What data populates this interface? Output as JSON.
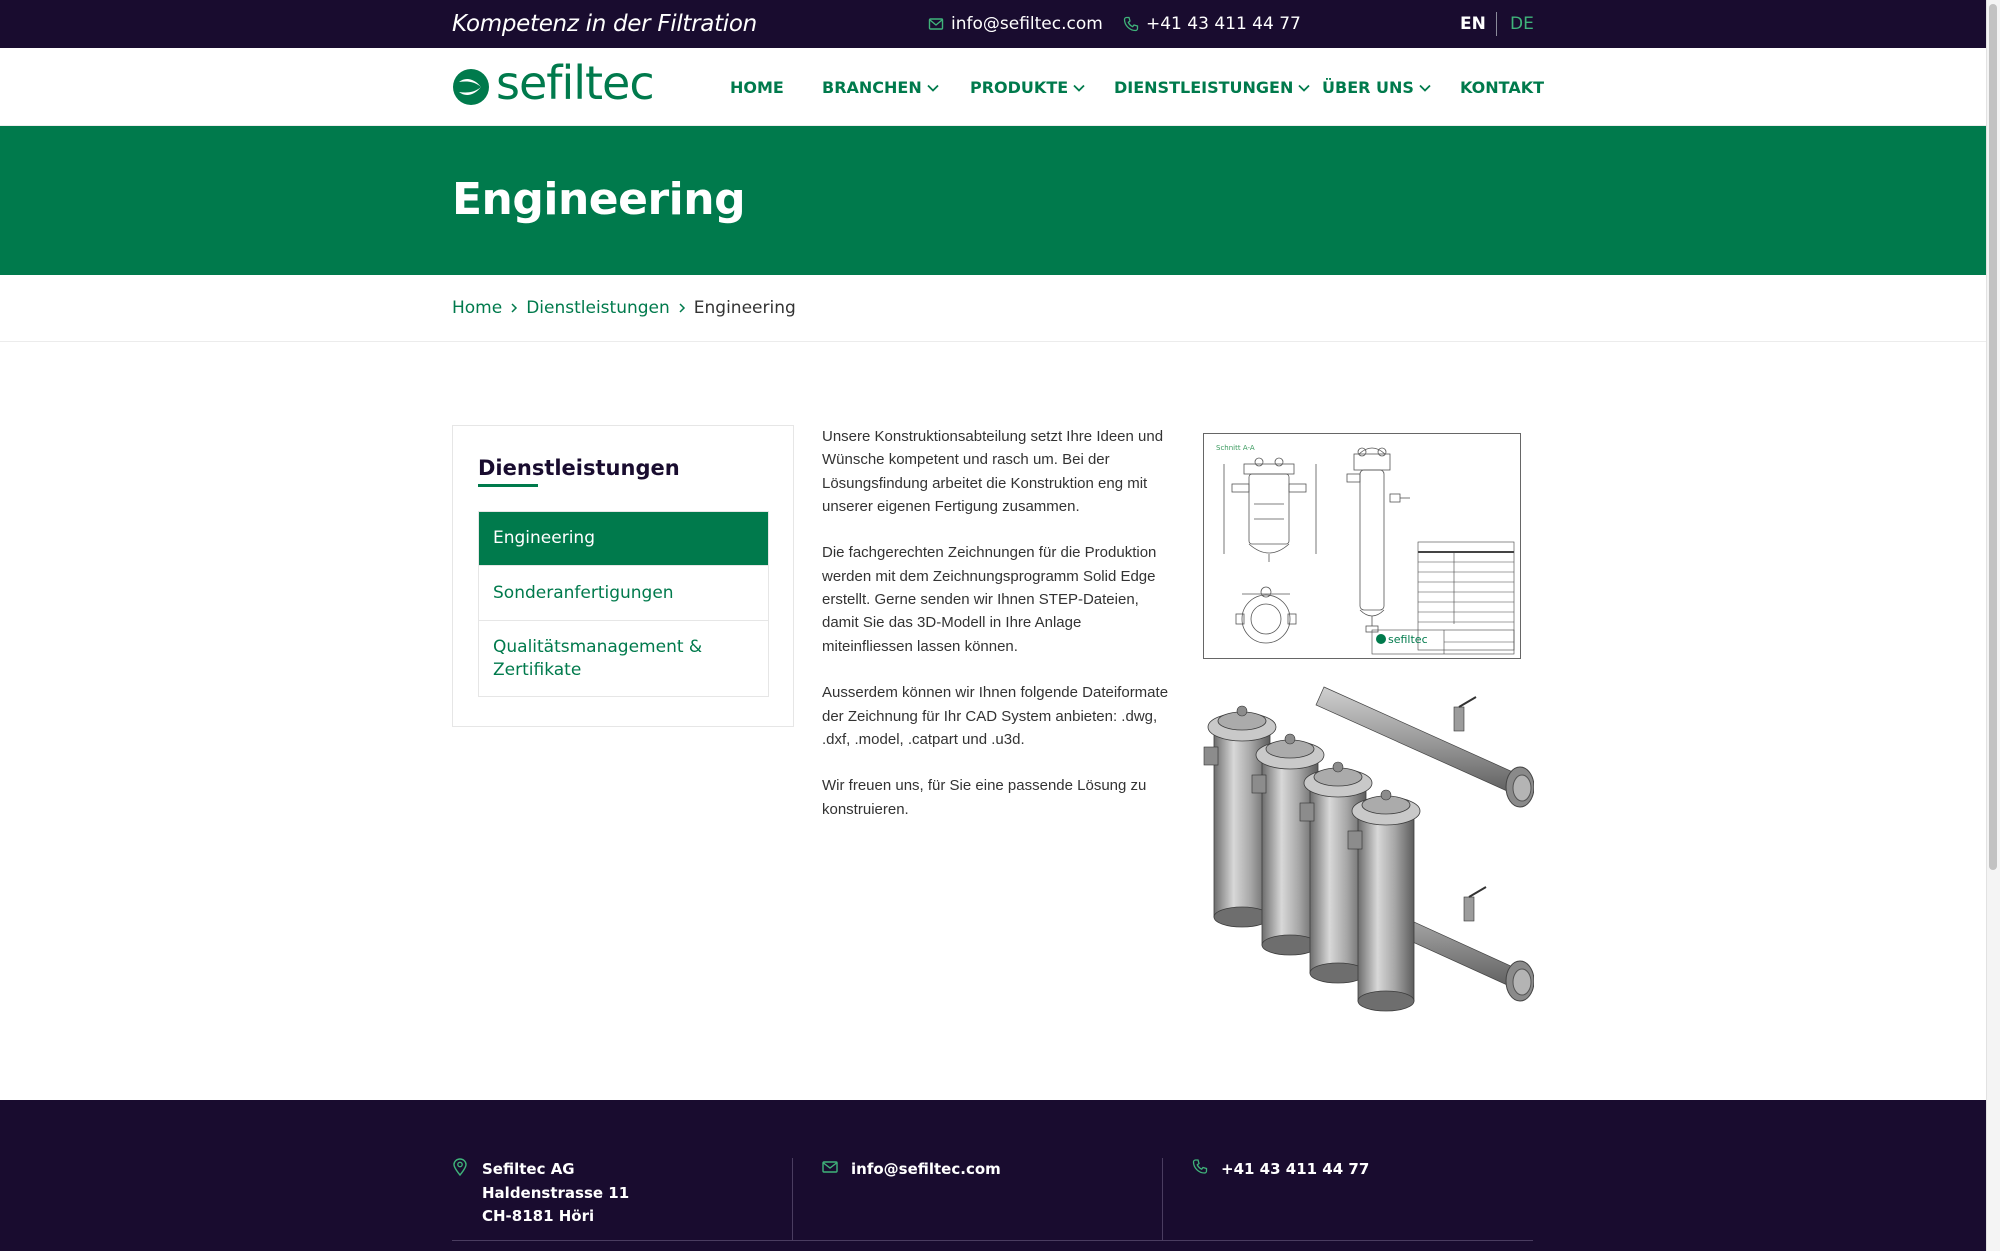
{
  "topbar": {
    "tagline": "Kompetenz in der Filtration",
    "email": "info@sefiltec.com",
    "phone": "+41 43 411 44 77",
    "languages": [
      {
        "code": "EN",
        "active": true
      },
      {
        "code": "DE",
        "active": false
      }
    ]
  },
  "header": {
    "logo_text": "sefiltec",
    "nav": [
      {
        "label": "HOME",
        "has_dropdown": false
      },
      {
        "label": "BRANCHEN",
        "has_dropdown": true
      },
      {
        "label": "PRODUKTE",
        "has_dropdown": true
      },
      {
        "label": "DIENSTLEISTUNGEN",
        "has_dropdown": true
      },
      {
        "label": "ÜBER UNS",
        "has_dropdown": true
      },
      {
        "label": "KONTAKT",
        "has_dropdown": false
      }
    ]
  },
  "hero": {
    "title": "Engineering"
  },
  "breadcrumb": {
    "items": [
      "Home",
      "Dienstleistungen"
    ],
    "current": "Engineering"
  },
  "sidebar": {
    "title": "Dienstleistungen",
    "items": [
      {
        "label": "Engineering",
        "active": true
      },
      {
        "label": "Sonderanfertigungen",
        "active": false
      },
      {
        "label": "Qualitätsmanagement & Zertifikate",
        "active": false
      }
    ]
  },
  "content": {
    "paragraphs": [
      "Unsere Konstruktionsabteilung setzt Ihre Ideen und Wünsche kompetent und rasch um. Bei der Lösungsfindung arbeitet die Konstruktion eng mit unserer eigenen Fertigung zusammen.",
      "Die fachgerechten Zeichnungen für die Produktion werden mit dem Zeichnungsprogramm Solid Edge erstellt. Gerne senden wir Ihnen STEP-Dateien, damit Sie das 3D-Modell in Ihre Anlage miteinfliessen lassen können.",
      "Ausserdem können wir Ihnen folgende Dateiformate der Zeichnung für Ihr CAD System anbieten: .dwg, .dxf, .model, .catpart und .u3d.",
      "Wir freuen uns, für Sie eine passende Lösung zu konstruieren."
    ]
  },
  "images": {
    "drawing_logo": "sefiltec",
    "drawing_label": "Schnitt A-A"
  },
  "footer": {
    "company": "Sefiltec AG",
    "street": "Haldenstrasse 11",
    "city": "CH-8181 Höri",
    "email": "info@sefiltec.com",
    "phone": "+41 43 411 44 77"
  },
  "colors": {
    "brand_green": "#007a4c",
    "dark_navy": "#190c2f",
    "lang_inactive": "#3fb37a"
  },
  "icons": {
    "email": "envelope-icon",
    "phone": "phone-icon",
    "location": "map-pin-icon",
    "dropdown": "chevron-down-icon",
    "breadcrumb_sep": "chevron-right-icon"
  }
}
